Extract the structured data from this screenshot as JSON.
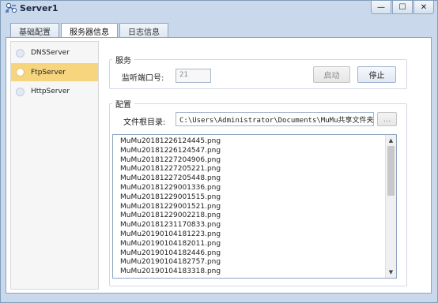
{
  "window": {
    "title": "Server1",
    "controls": {
      "minimize": "—",
      "maximize": "☐",
      "close": "✕"
    }
  },
  "tabs": [
    {
      "label": "基础配置",
      "active": false
    },
    {
      "label": "服务器信息",
      "active": true
    },
    {
      "label": "日志信息",
      "active": false
    }
  ],
  "sidebar": {
    "items": [
      {
        "label": "DNSServer",
        "active": false
      },
      {
        "label": "FtpServer",
        "active": true
      },
      {
        "label": "HttpServer",
        "active": false
      }
    ]
  },
  "service": {
    "group_title": "服务",
    "port_label": "监听端口号:",
    "port_value": "21",
    "start_label": "启动",
    "stop_label": "停止"
  },
  "config": {
    "group_title": "配置",
    "root_label": "文件根目录:",
    "root_value": "C:\\Users\\Administrator\\Documents\\MuMu共享文件夹",
    "browse_label": "...",
    "files": [
      "MuMu20181226124445.png",
      "MuMu20181226124547.png",
      "MuMu20181227204906.png",
      "MuMu20181227205221.png",
      "MuMu20181227205448.png",
      "MuMu20181229001336.png",
      "MuMu20181229001515.png",
      "MuMu20181229001521.png",
      "MuMu20181229002218.png",
      "MuMu20181231170833.png",
      "MuMu20190104181223.png",
      "MuMu20190104182011.png",
      "MuMu20190104182446.png",
      "MuMu20190104182757.png",
      "MuMu20190104183318.png"
    ]
  },
  "colors": {
    "window_bg": "#c9d8ea",
    "active_item": "#f7d57e",
    "border": "#8ea4c0"
  },
  "icons": {
    "app": "network-server-icon",
    "scroll_up": "▲",
    "scroll_down": "▼"
  }
}
